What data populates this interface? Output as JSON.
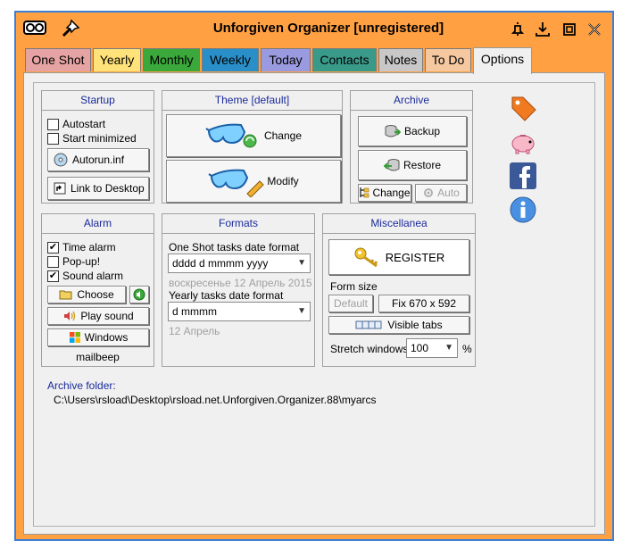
{
  "window": {
    "title": "Unforgiven Organizer [unregistered]"
  },
  "tabs": [
    {
      "label": "One Shot",
      "color": "#e6a3a3"
    },
    {
      "label": "Yearly",
      "color": "#ffe37a"
    },
    {
      "label": "Monthly",
      "color": "#3aa83a"
    },
    {
      "label": "Weekly",
      "color": "#2a8fc8"
    },
    {
      "label": "Today",
      "color": "#9a9ae0"
    },
    {
      "label": "Contacts",
      "color": "#3a9a8a"
    },
    {
      "label": "Notes",
      "color": "#c8c8c8"
    },
    {
      "label": "To Do",
      "color": "#f5c8a0"
    },
    {
      "label": "Options",
      "color": "#f0f0f0"
    }
  ],
  "startup": {
    "title": "Startup",
    "autostart": "Autostart",
    "autostart_checked": false,
    "start_minimized": "Start minimized",
    "start_minimized_checked": false,
    "autorun_button": "Autorun.inf",
    "link_button": "Link to Desktop"
  },
  "theme": {
    "title": "Theme [default]",
    "change_button": "Change",
    "modify_button": "Modify"
  },
  "archive": {
    "title": "Archive",
    "backup_button": "Backup",
    "restore_button": "Restore",
    "change_button": "Change",
    "auto_button": "Auto"
  },
  "alarm": {
    "title": "Alarm",
    "time_alarm": "Time alarm",
    "time_alarm_checked": true,
    "popup": "Pop-up!",
    "popup_checked": false,
    "sound_alarm": "Sound alarm",
    "sound_alarm_checked": true,
    "choose_button": "Choose",
    "play_sound_button": "Play sound",
    "windows_button": "Windows",
    "sound_name": "mailbeep"
  },
  "formats": {
    "title": "Formats",
    "oneshot_label": "One Shot tasks date format",
    "oneshot_value": "dddd d mmmm yyyy",
    "oneshot_preview": "воскресенье 12 Апрель 2015",
    "yearly_label": "Yearly tasks date format",
    "yearly_value": "d mmmm",
    "yearly_preview": "12 Апрель"
  },
  "misc": {
    "title": "Miscellanea",
    "register_button": "REGISTER",
    "form_size_label": "Form size",
    "default_button": "Default",
    "fix_button": "Fix 670 x 592",
    "visible_tabs_button": "Visible tabs",
    "stretch_label": "Stretch windows",
    "stretch_value": "100",
    "percent": "%"
  },
  "archive_folder": {
    "label": "Archive folder:",
    "path": "C:\\Users\\rsload\\Desktop\\rsload.net.Unforgiven.Organizer.88\\myarcs"
  },
  "side_icons": [
    "tag-icon",
    "piggy-bank-icon",
    "facebook-icon",
    "info-icon"
  ]
}
